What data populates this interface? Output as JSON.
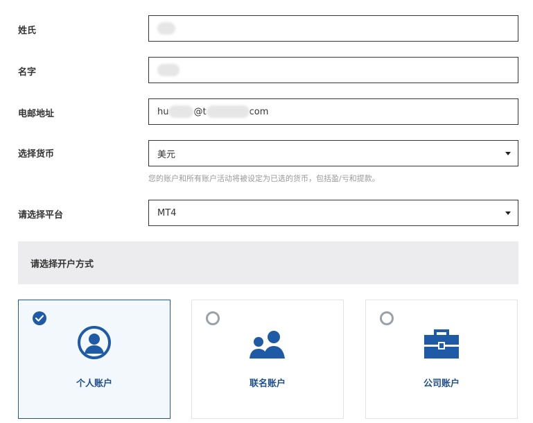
{
  "form": {
    "last_name": {
      "label": "姓氏",
      "value": ""
    },
    "first_name": {
      "label": "名字",
      "value": ""
    },
    "email": {
      "label": "电邮地址",
      "prefix": "hu",
      "mid": "@t",
      "suffix": "com"
    },
    "currency": {
      "label": "选择货币",
      "value": "美元",
      "help": "您的账户和所有账户活动将被设定为已选的货币，包括盈/亏和提款。"
    },
    "platform": {
      "label": "请选择平台",
      "value": "MT4"
    }
  },
  "account_type": {
    "title": "请选择开户方式",
    "options": [
      {
        "label": "个人账户",
        "icon": "user-circle-icon",
        "selected": true
      },
      {
        "label": "联名账户",
        "icon": "users-icon",
        "selected": false
      },
      {
        "label": "公司账户",
        "icon": "briefcase-icon",
        "selected": false
      }
    ]
  },
  "colors": {
    "accent": "#1f5aa6",
    "selected_bg": "#f3f8fd",
    "section_bg": "#ececee"
  }
}
